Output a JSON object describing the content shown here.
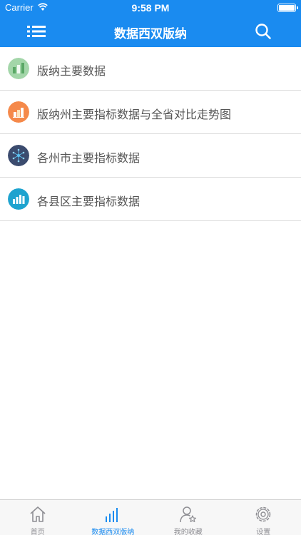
{
  "status_bar": {
    "carrier": "Carrier",
    "time": "9:58 PM"
  },
  "nav": {
    "title": "数据西双版纳",
    "menu_icon": "list-menu-icon",
    "search_icon": "search-icon"
  },
  "list": {
    "items": [
      {
        "label": "版纳主要数据",
        "icon": "bar-chart-icon",
        "icon_color": "#a3d6a9"
      },
      {
        "label": "版纳州主要指标数据与全省对比走势图",
        "icon": "bar-trend-icon",
        "icon_color": "#f5894a"
      },
      {
        "label": "各州市主要指标数据",
        "icon": "network-icon",
        "icon_color": "#3b4b6e"
      },
      {
        "label": "各县区主要指标数据",
        "icon": "column-chart-icon",
        "icon_color": "#1ea3cf"
      }
    ]
  },
  "tabbar": {
    "active_color": "#1a8bf0",
    "tabs": [
      {
        "label": "首页",
        "icon": "home-icon",
        "active": false
      },
      {
        "label": "数据西双版纳",
        "icon": "chart-bars-icon",
        "active": true
      },
      {
        "label": "我的收藏",
        "icon": "user-star-icon",
        "active": false
      },
      {
        "label": "设置",
        "icon": "gear-icon",
        "active": false
      }
    ]
  }
}
